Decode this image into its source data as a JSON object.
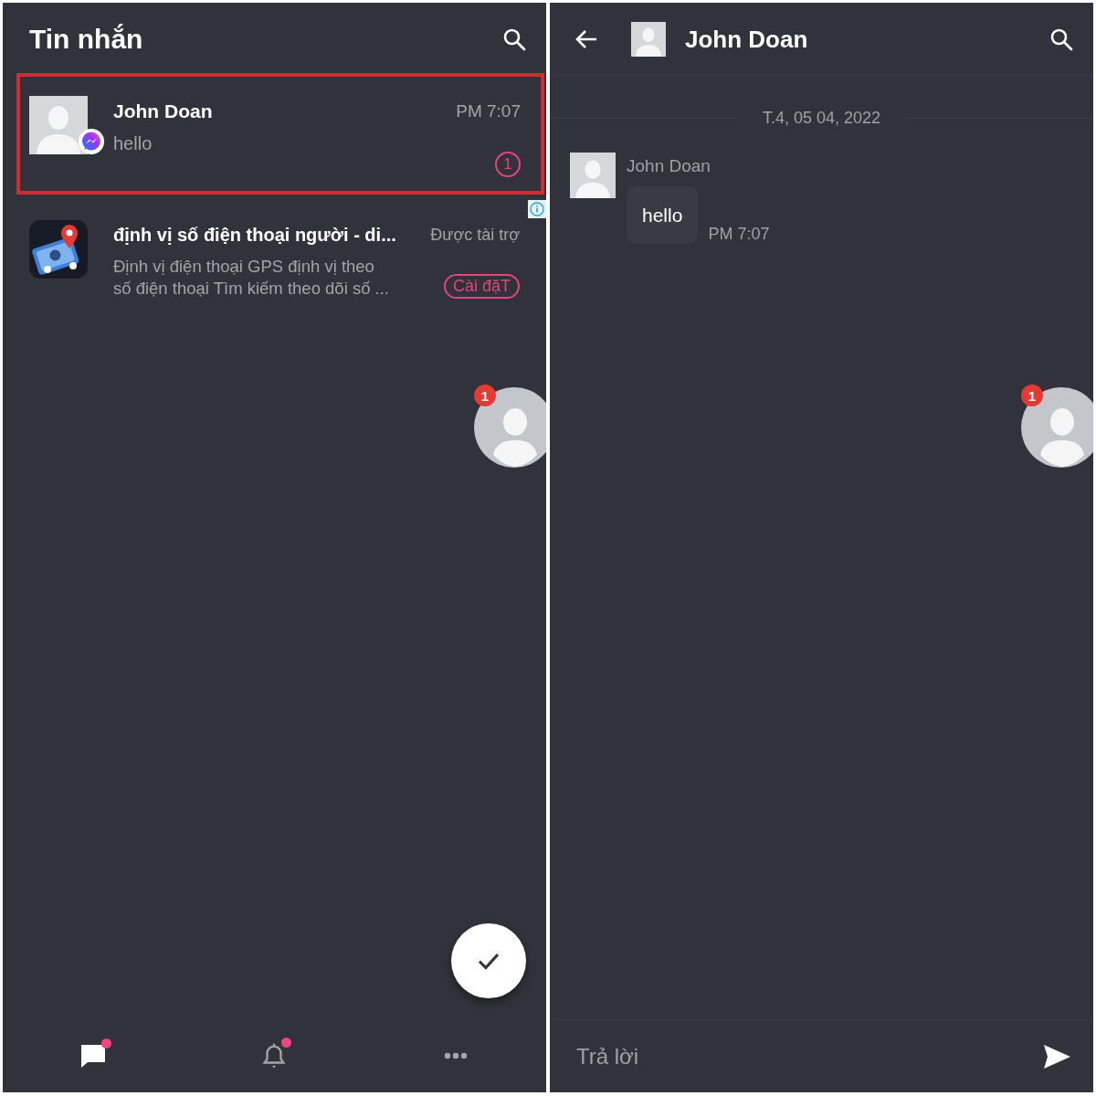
{
  "inbox": {
    "title": "Tin nhắn",
    "conversations": [
      {
        "name": "John Doan",
        "preview": "hello",
        "time": "PM 7:07",
        "unread_count": "1",
        "highlighted": true
      }
    ],
    "ad": {
      "title": "định vị số điện thoại người - di...",
      "sponsored_label": "Được tài trợ",
      "description": "Định vị điện thoại GPS định vị theo\nsố điện thoại Tìm kiếm theo dõi số ...",
      "install_button": "Cài đặT"
    },
    "chat_head_badge": "1",
    "bottom_nav": [
      {
        "kind": "chat",
        "selected": true,
        "has_dot": true
      },
      {
        "kind": "bell",
        "selected": false,
        "has_dot": true
      },
      {
        "kind": "more",
        "selected": false,
        "has_dot": false
      }
    ]
  },
  "chat": {
    "title": "John Doan",
    "date_separator": "T.4, 05 04, 2022",
    "messages": [
      {
        "sender": "John Doan",
        "text": "hello",
        "time": "PM 7:07"
      }
    ],
    "chat_head_badge": "1",
    "reply": {
      "placeholder": "Trả lời"
    }
  }
}
